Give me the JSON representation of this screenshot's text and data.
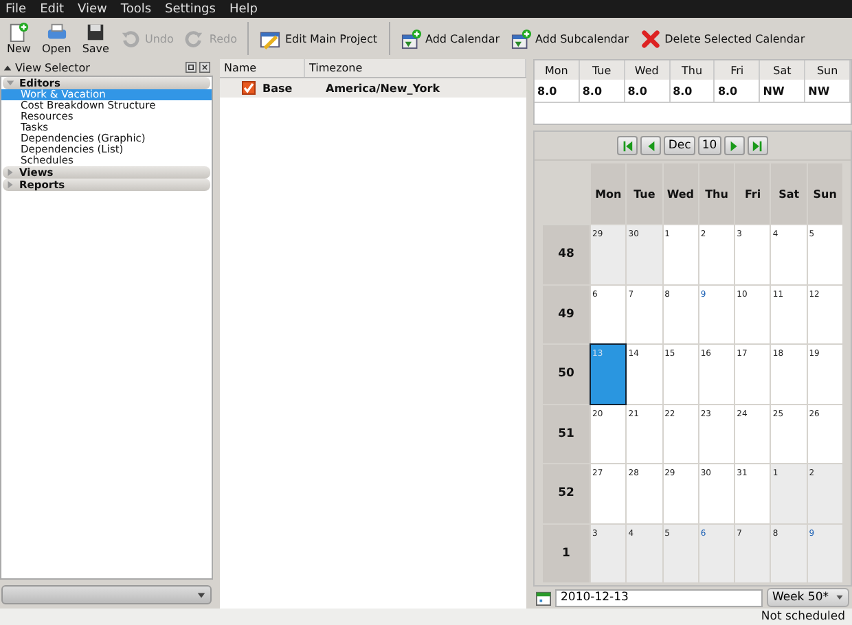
{
  "menu": [
    "File",
    "Edit",
    "View",
    "Tools",
    "Settings",
    "Help"
  ],
  "toolbar": [
    {
      "label": "New",
      "disabled": false
    },
    {
      "label": "Open",
      "disabled": false
    },
    {
      "label": "Save",
      "disabled": false
    },
    {
      "label": "Undo",
      "disabled": true
    },
    {
      "label": "Redo",
      "disabled": true
    }
  ],
  "actions": [
    {
      "label": "Edit Main Project"
    },
    {
      "label": "Add Calendar"
    },
    {
      "label": "Add Subcalendar"
    },
    {
      "label": "Delete Selected Calendar"
    }
  ],
  "view_selector": {
    "title": "View Selector",
    "sections": [
      {
        "label": "Editors",
        "expanded": true,
        "children": [
          {
            "label": "Work & Vacation",
            "selected": true
          },
          {
            "label": "Cost Breakdown Structure",
            "selected": false
          },
          {
            "label": "Resources",
            "selected": false
          },
          {
            "label": "Tasks",
            "selected": false
          },
          {
            "label": "Dependencies (Graphic)",
            "selected": false
          },
          {
            "label": "Dependencies (List)",
            "selected": false
          },
          {
            "label": "Schedules",
            "selected": false
          }
        ]
      },
      {
        "label": "Views",
        "expanded": false
      },
      {
        "label": "Reports",
        "expanded": false
      }
    ]
  },
  "calendars": {
    "columns": [
      "Name",
      "Timezone"
    ],
    "rows": [
      {
        "name": "Base",
        "timezone": "America/New_York",
        "checked": true
      }
    ]
  },
  "work_hours": {
    "days": [
      "Mon",
      "Tue",
      "Wed",
      "Thu",
      "Fri",
      "Sat",
      "Sun"
    ],
    "values": [
      "8.0",
      "8.0",
      "8.0",
      "8.0",
      "8.0",
      "NW",
      "NW"
    ]
  },
  "navigator": {
    "month": "Dec",
    "year": "10"
  },
  "month": {
    "weekdays": [
      "Mon",
      "Tue",
      "Wed",
      "Thu",
      "Fri",
      "Sat",
      "Sun"
    ],
    "weeks": [
      {
        "week": "48",
        "days": [
          {
            "day": "29",
            "other": true,
            "marked": false,
            "selected": false
          },
          {
            "day": "30",
            "other": true,
            "marked": false,
            "selected": false
          },
          {
            "day": "1",
            "other": false,
            "marked": false,
            "selected": false
          },
          {
            "day": "2",
            "other": false,
            "marked": false,
            "selected": false
          },
          {
            "day": "3",
            "other": false,
            "marked": false,
            "selected": false
          },
          {
            "day": "4",
            "other": false,
            "marked": false,
            "selected": false
          },
          {
            "day": "5",
            "other": false,
            "marked": false,
            "selected": false
          }
        ]
      },
      {
        "week": "49",
        "days": [
          {
            "day": "6",
            "other": false,
            "marked": false,
            "selected": false
          },
          {
            "day": "7",
            "other": false,
            "marked": false,
            "selected": false
          },
          {
            "day": "8",
            "other": false,
            "marked": false,
            "selected": false
          },
          {
            "day": "9",
            "other": false,
            "marked": true,
            "selected": false
          },
          {
            "day": "10",
            "other": false,
            "marked": false,
            "selected": false
          },
          {
            "day": "11",
            "other": false,
            "marked": false,
            "selected": false
          },
          {
            "day": "12",
            "other": false,
            "marked": false,
            "selected": false
          }
        ]
      },
      {
        "week": "50",
        "days": [
          {
            "day": "13",
            "other": false,
            "marked": false,
            "selected": true
          },
          {
            "day": "14",
            "other": false,
            "marked": false,
            "selected": false
          },
          {
            "day": "15",
            "other": false,
            "marked": false,
            "selected": false
          },
          {
            "day": "16",
            "other": false,
            "marked": false,
            "selected": false
          },
          {
            "day": "17",
            "other": false,
            "marked": false,
            "selected": false
          },
          {
            "day": "18",
            "other": false,
            "marked": false,
            "selected": false
          },
          {
            "day": "19",
            "other": false,
            "marked": false,
            "selected": false
          }
        ]
      },
      {
        "week": "51",
        "days": [
          {
            "day": "20",
            "other": false,
            "marked": false,
            "selected": false
          },
          {
            "day": "21",
            "other": false,
            "marked": false,
            "selected": false
          },
          {
            "day": "22",
            "other": false,
            "marked": false,
            "selected": false
          },
          {
            "day": "23",
            "other": false,
            "marked": false,
            "selected": false
          },
          {
            "day": "24",
            "other": false,
            "marked": false,
            "selected": false
          },
          {
            "day": "25",
            "other": false,
            "marked": false,
            "selected": false
          },
          {
            "day": "26",
            "other": false,
            "marked": false,
            "selected": false
          }
        ]
      },
      {
        "week": "52",
        "days": [
          {
            "day": "27",
            "other": false,
            "marked": false,
            "selected": false
          },
          {
            "day": "28",
            "other": false,
            "marked": false,
            "selected": false
          },
          {
            "day": "29",
            "other": false,
            "marked": false,
            "selected": false
          },
          {
            "day": "30",
            "other": false,
            "marked": false,
            "selected": false
          },
          {
            "day": "31",
            "other": false,
            "marked": false,
            "selected": false
          },
          {
            "day": "1",
            "other": true,
            "marked": false,
            "selected": false
          },
          {
            "day": "2",
            "other": true,
            "marked": false,
            "selected": false
          }
        ]
      },
      {
        "week": "1",
        "days": [
          {
            "day": "3",
            "other": true,
            "marked": false,
            "selected": false
          },
          {
            "day": "4",
            "other": true,
            "marked": false,
            "selected": false
          },
          {
            "day": "5",
            "other": true,
            "marked": false,
            "selected": false
          },
          {
            "day": "6",
            "other": true,
            "marked": true,
            "selected": false
          },
          {
            "day": "7",
            "other": true,
            "marked": false,
            "selected": false
          },
          {
            "day": "8",
            "other": true,
            "marked": false,
            "selected": false
          },
          {
            "day": "9",
            "other": true,
            "marked": true,
            "selected": false
          }
        ]
      }
    ]
  },
  "date_field": {
    "value": "2010-12-13"
  },
  "week_select": {
    "value": "Week 50*"
  },
  "status_bar": "Not scheduled"
}
